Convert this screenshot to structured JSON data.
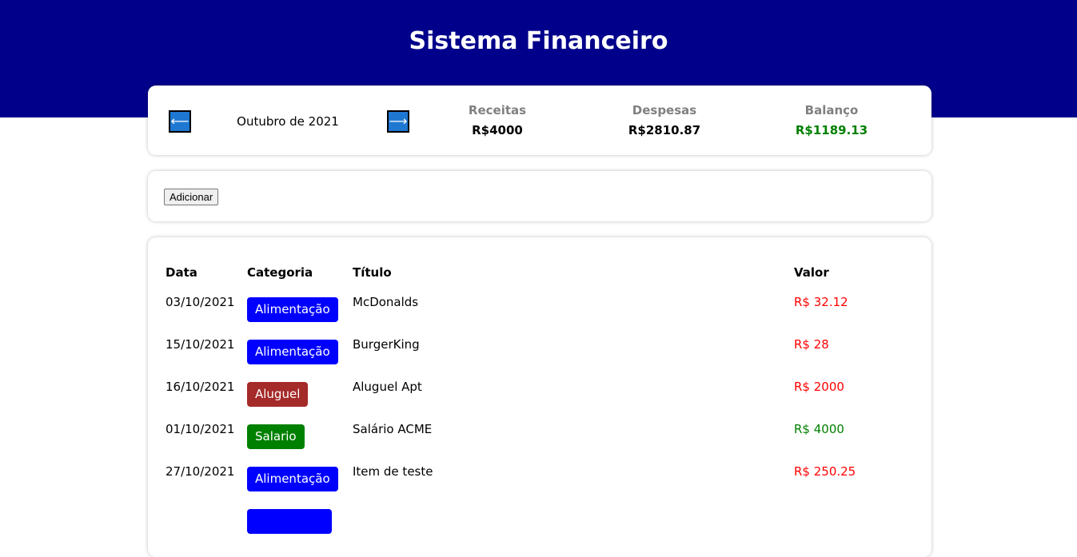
{
  "app": {
    "title": "Sistema Financeiro"
  },
  "colors": {
    "header": "#00008b",
    "nav_arrow": "#1e78d2",
    "positive": "#008000",
    "negative": "#ff0000",
    "cat_alimentacao": "#0000ff",
    "cat_aluguel": "#a52a2a",
    "cat_salario": "#008000"
  },
  "info": {
    "prev_icon": "arrow-left-icon",
    "prev_glyph": "⟵",
    "next_icon": "arrow-right-icon",
    "next_glyph": "⟶",
    "month": "Outubro de 2021",
    "receitas_label": "Receitas",
    "receitas_value": "R$4000",
    "despesas_label": "Despesas",
    "despesas_value": "R$2810.87",
    "balanco_label": "Balanço",
    "balanco_value": "R$1189.13"
  },
  "actions": {
    "add_label": "Adicionar"
  },
  "table": {
    "headers": {
      "data": "Data",
      "categoria": "Categoria",
      "titulo": "Título",
      "valor": "Valor"
    },
    "rows": [
      {
        "data": "03/10/2021",
        "categoria": "Alimentação",
        "cat_color": "#0000ff",
        "titulo": "McDonalds",
        "valor": "R$ 32.12",
        "valor_color": "#ff0000"
      },
      {
        "data": "15/10/2021",
        "categoria": "Alimentação",
        "cat_color": "#0000ff",
        "titulo": "BurgerKing",
        "valor": "R$ 28",
        "valor_color": "#ff0000"
      },
      {
        "data": "16/10/2021",
        "categoria": "Aluguel",
        "cat_color": "#a52a2a",
        "titulo": "Aluguel Apt",
        "valor": "R$ 2000",
        "valor_color": "#ff0000"
      },
      {
        "data": "01/10/2021",
        "categoria": "Salario",
        "cat_color": "#008000",
        "titulo": "Salário ACME",
        "valor": "R$ 4000",
        "valor_color": "#008000"
      },
      {
        "data": "27/10/2021",
        "categoria": "Alimentação",
        "cat_color": "#0000ff",
        "titulo": "Item de teste",
        "valor": "R$ 250.25",
        "valor_color": "#ff0000"
      }
    ]
  }
}
